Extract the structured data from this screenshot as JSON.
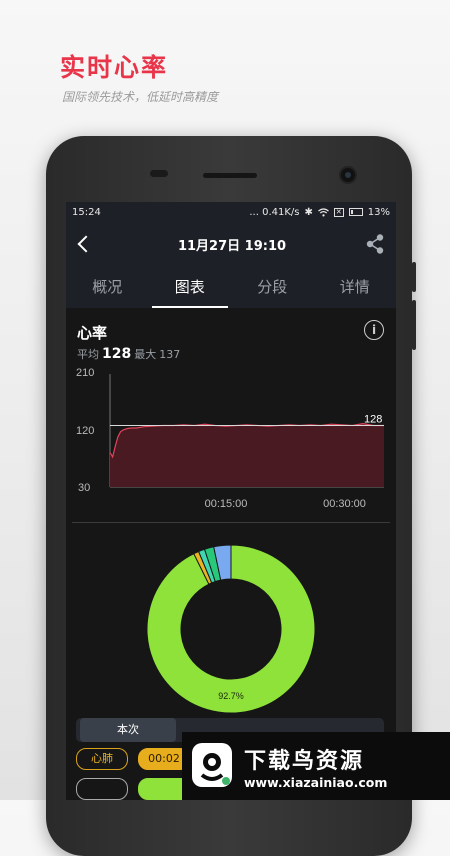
{
  "promo": {
    "title": "实时心率",
    "subtitle": "国际领先技术，低延时高精度"
  },
  "statusbar": {
    "time": "15:24",
    "network": "... 0.41K/s",
    "battery": "13%"
  },
  "appbar": {
    "title": "11月27日 19:10",
    "back_icon": "chevron-left-icon",
    "share_icon": "share-icon"
  },
  "tabs": [
    {
      "label": "概况",
      "active": false
    },
    {
      "label": "图表",
      "active": true
    },
    {
      "label": "分段",
      "active": false
    },
    {
      "label": "详情",
      "active": false
    }
  ],
  "heart_rate": {
    "title": "心率",
    "avg_label": "平均",
    "avg_value": "128",
    "max_label": "最大",
    "max_value": "137"
  },
  "chart_data": [
    {
      "type": "area",
      "title": "心率",
      "ylim": [
        30,
        210
      ],
      "yticks": [
        "210",
        "120",
        "30"
      ],
      "xticks": [
        {
          "label": "00:15:00",
          "t": 900
        },
        {
          "label": "00:30:00",
          "t": 1800
        }
      ],
      "x_range_seconds": [
        0,
        2080
      ],
      "reference_line": {
        "value": 128,
        "label": "128"
      },
      "series": [
        {
          "color": "#e0455a",
          "fill": "#4a1a22",
          "x": [
            0,
            20,
            40,
            60,
            80,
            100,
            130,
            160,
            200,
            260,
            320,
            400,
            480,
            560,
            640,
            720,
            800,
            880,
            960,
            1040,
            1120,
            1200,
            1280,
            1360,
            1440,
            1520,
            1600,
            1680,
            1760,
            1840,
            1920,
            2000,
            2080
          ],
          "values": [
            85,
            78,
            95,
            110,
            118,
            121,
            123,
            124,
            124,
            126,
            127,
            128,
            128,
            129,
            128,
            130,
            128,
            127,
            128,
            129,
            128,
            127,
            128,
            129,
            128,
            129,
            128,
            130,
            129,
            128,
            131,
            128,
            128
          ]
        }
      ]
    },
    {
      "type": "pie",
      "donut": true,
      "slices": [
        {
          "value": 92.7,
          "color": "#8ee23a",
          "label": "92.7%"
        },
        {
          "value": 1.0,
          "color": "#e9b424"
        },
        {
          "value": 1.2,
          "color": "#3fd6b2"
        },
        {
          "value": 1.8,
          "color": "#27c87a"
        },
        {
          "value": 3.3,
          "color": "#79aaf0"
        }
      ]
    }
  ],
  "segment": {
    "active_label": "本次"
  },
  "chips": [
    {
      "label": "心肺"
    },
    {
      "label": "00:02"
    }
  ],
  "watermark": {
    "cn": "下载鸟资源",
    "en": "www.xiazainiao.com"
  },
  "colors": {
    "accent": "#e8354a",
    "panel": "#1d2127",
    "screen_bg": "#161616"
  }
}
